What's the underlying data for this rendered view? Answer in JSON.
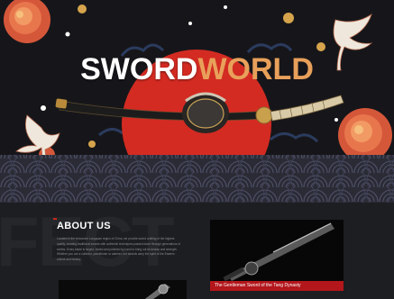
{
  "hero": {
    "logo_part1": "SWORD",
    "logo_part2": "WORLD"
  },
  "about": {
    "watermark": "FECT",
    "title": "ABOUT US",
    "body": "Located in the renowned Longquan region of China, we provide sword crafting of the highest quality, creating traditional swords with authentic techniques passed down through generations of smiths. Every blade is forged, folded and polished by hand to bring out its beauty and strength. Whether you are a collector, practitioner or admirer, our swords carry the spirit of the Eastern culture and history."
  },
  "products": [
    {
      "caption": "The Gentleman Sword of the Tang Dynasty"
    },
    {
      "caption": ""
    }
  ],
  "colors": {
    "accent_red": "#c8281e",
    "logo_orange": "#e8a05a",
    "background": "#1b1c1f"
  }
}
